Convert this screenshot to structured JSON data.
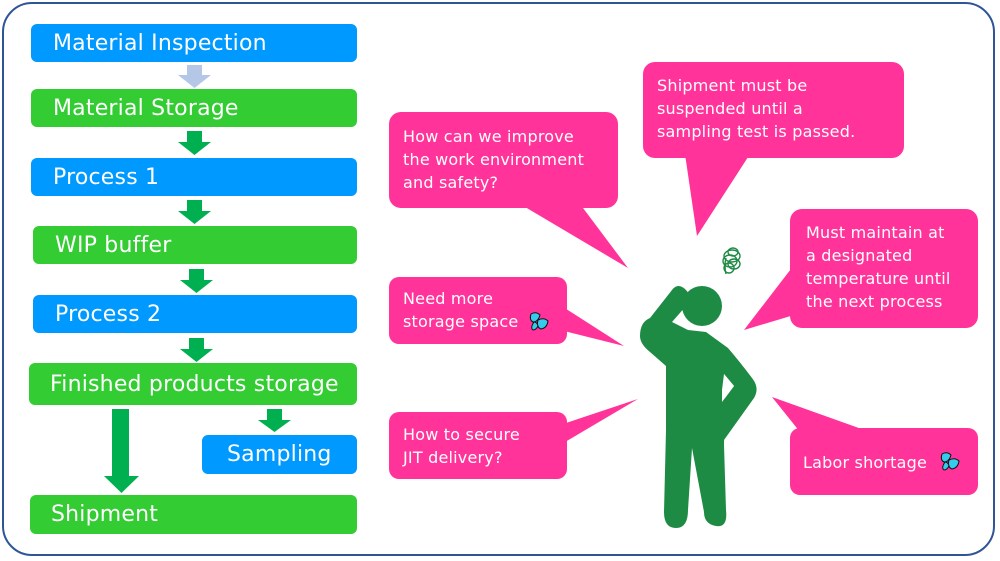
{
  "colors": {
    "frame": "#2F5597",
    "process_blue": "#0099FF",
    "storage_green": "#33CC33",
    "arrow_green": "#00B050",
    "arrow_light": "#B4C7E7",
    "bubble_pink": "#FF3399",
    "person_green": "#1E8B44",
    "sweat_blue": "#33CCEE"
  },
  "flow": {
    "steps": [
      {
        "label": "Material Inspection",
        "type": "process"
      },
      {
        "label": "Material Storage",
        "type": "storage"
      },
      {
        "label": "Process 1",
        "type": "process"
      },
      {
        "label": "WIP buffer",
        "type": "storage"
      },
      {
        "label": "Process 2",
        "type": "process"
      },
      {
        "label": "Finished products storage",
        "type": "storage"
      },
      {
        "label": "Sampling",
        "type": "process"
      },
      {
        "label": "Shipment",
        "type": "storage"
      }
    ]
  },
  "bubbles": [
    {
      "id": "work-environment",
      "text": "How can we improve\nthe work environment\nand safety?",
      "icon": null
    },
    {
      "id": "storage-space",
      "text": "Need more\nstorage space",
      "icon": "sweat-drops-icon"
    },
    {
      "id": "jit-delivery",
      "text": "How to secure\nJIT delivery?",
      "icon": null
    },
    {
      "id": "shipment-suspended",
      "text": "Shipment must be\nsuspended until a\nsampling test is passed.",
      "icon": null
    },
    {
      "id": "temperature",
      "text": "Must maintain at\na designated\ntemperature until\nthe next process",
      "icon": null
    },
    {
      "id": "labor-shortage",
      "text": "Labor shortage",
      "icon": "sweat-drops-icon"
    }
  ],
  "figure": {
    "description": "worried person scratching head",
    "icon": "confused-scribble-icon"
  }
}
